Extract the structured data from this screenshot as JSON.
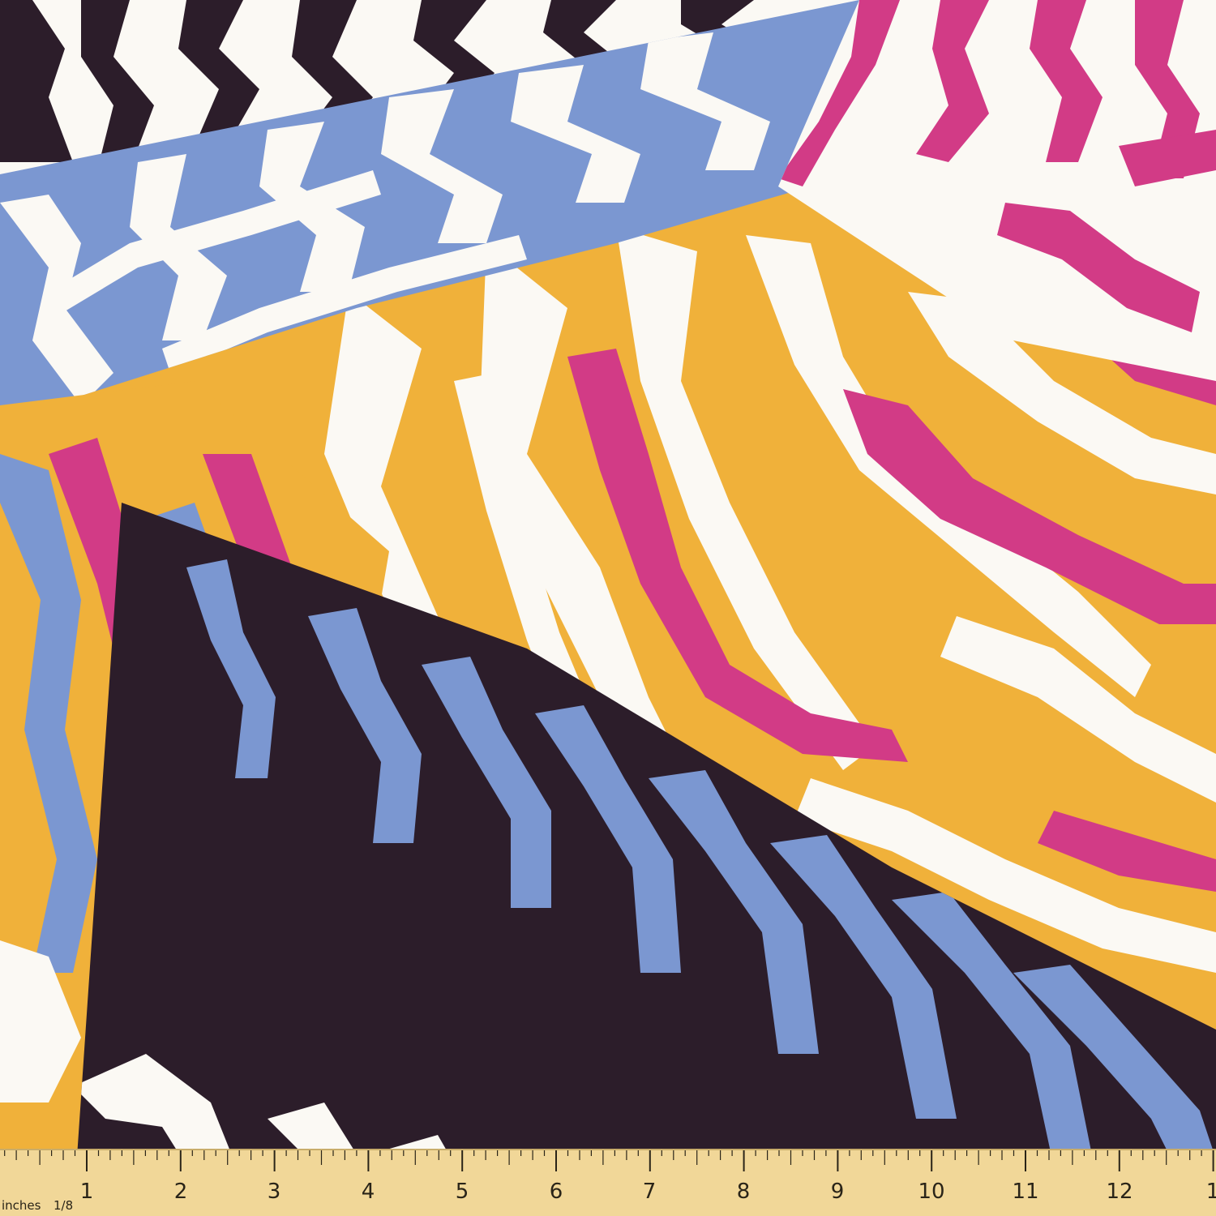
{
  "image": {
    "subject": "zebra stripe patchwork fabric",
    "colors": {
      "white": "#fbf9f4",
      "black": "#2c1d2a",
      "blue": "#7b97d1",
      "pink": "#d23b86",
      "yellow": "#f0b13a",
      "ruler_wood": "#f1d798",
      "ruler_ink": "#2a2418"
    }
  },
  "ruler": {
    "unit_label": "inches",
    "fraction_label": "1/8",
    "numbers": [
      "1",
      "2",
      "3",
      "4",
      "5",
      "6",
      "7",
      "8",
      "9",
      "10",
      "11",
      "12",
      "1"
    ]
  }
}
